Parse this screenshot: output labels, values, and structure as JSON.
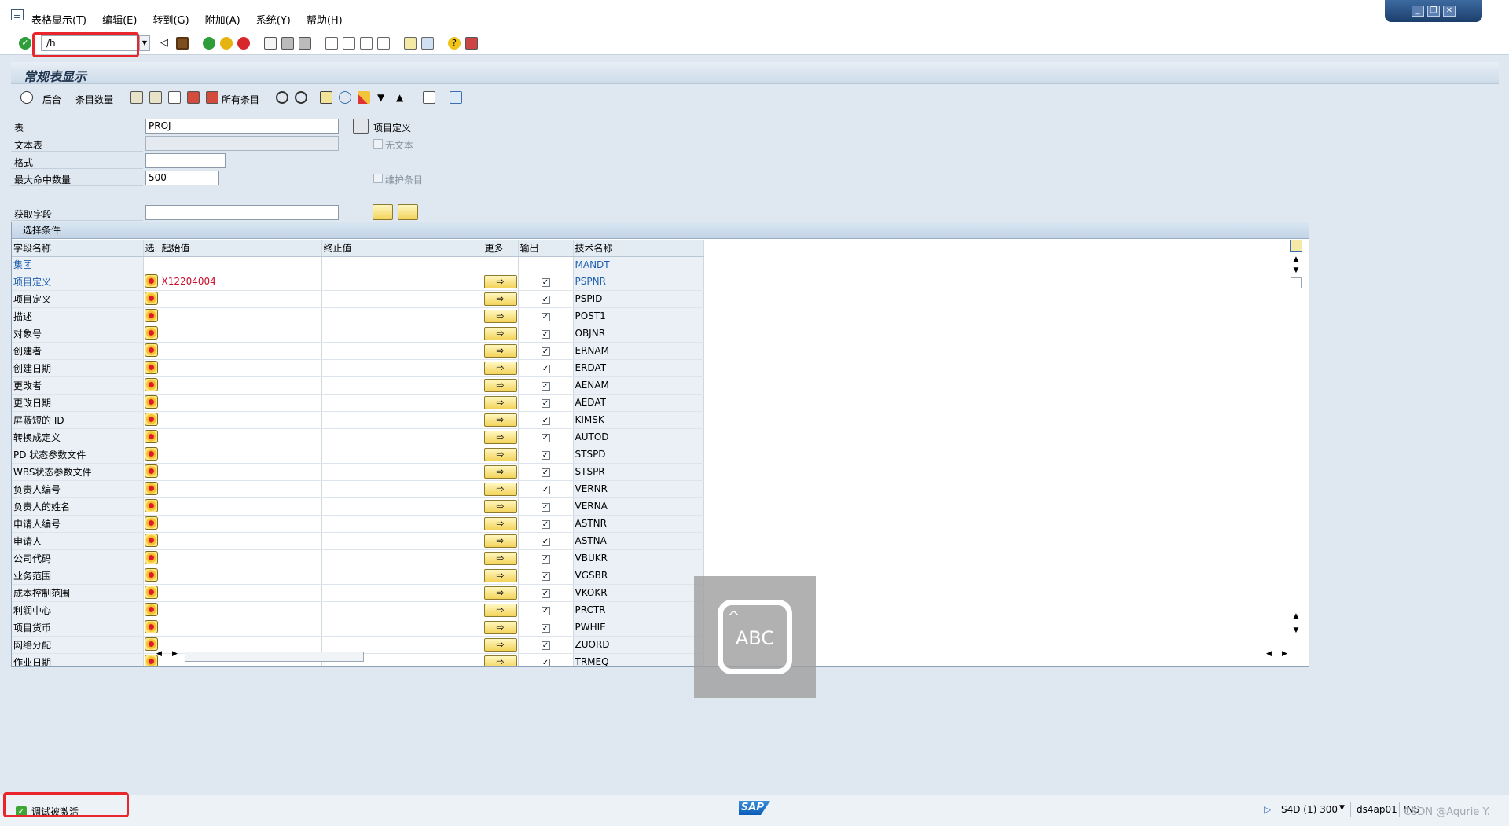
{
  "menu": [
    "表格显示(T)",
    "编辑(E)",
    "转到(G)",
    "附加(A)",
    "系统(Y)",
    "帮助(H)"
  ],
  "command_field": "/h",
  "title": "常规表显示",
  "appbar": {
    "background": "后台",
    "entry_count": "条目数量",
    "all_entries": "所有条目"
  },
  "form": {
    "table_label": "表",
    "table_value": "PROJ",
    "table_desc": "项目定义",
    "text_table_label": "文本表",
    "no_text_label": "无文本",
    "layout_label": "格式",
    "max_hits_label": "最大命中数量",
    "max_hits_value": "500",
    "maintain_entries_label": "维护条目",
    "get_fields_label": "获取字段"
  },
  "selection": {
    "caption": "选择条件",
    "columns": [
      "字段名称",
      "选.",
      "起始值",
      "终止值",
      "更多",
      "输出",
      "技术名称"
    ],
    "rows": [
      {
        "field": "集团",
        "from": "",
        "tech": "MANDT",
        "highlight": true,
        "has_controls": false
      },
      {
        "field": "项目定义",
        "from": "X12204004",
        "tech": "PSPNR",
        "highlight": true,
        "has_controls": true
      },
      {
        "field": "项目定义",
        "from": "",
        "tech": "PSPID",
        "highlight": false,
        "has_controls": true
      },
      {
        "field": "描述",
        "from": "",
        "tech": "POST1",
        "highlight": false,
        "has_controls": true
      },
      {
        "field": "对象号",
        "from": "",
        "tech": "OBJNR",
        "highlight": false,
        "has_controls": true
      },
      {
        "field": "创建者",
        "from": "",
        "tech": "ERNAM",
        "highlight": false,
        "has_controls": true
      },
      {
        "field": "创建日期",
        "from": "",
        "tech": "ERDAT",
        "highlight": false,
        "has_controls": true
      },
      {
        "field": "更改者",
        "from": "",
        "tech": "AENAM",
        "highlight": false,
        "has_controls": true
      },
      {
        "field": "更改日期",
        "from": "",
        "tech": "AEDAT",
        "highlight": false,
        "has_controls": true
      },
      {
        "field": "屏蔽短的 ID",
        "from": "",
        "tech": "KIMSK",
        "highlight": false,
        "has_controls": true
      },
      {
        "field": "转换成定义",
        "from": "",
        "tech": "AUTOD",
        "highlight": false,
        "has_controls": true
      },
      {
        "field": "PD 状态参数文件",
        "from": "",
        "tech": "STSPD",
        "highlight": false,
        "has_controls": true
      },
      {
        "field": "WBS状态参数文件",
        "from": "",
        "tech": "STSPR",
        "highlight": false,
        "has_controls": true
      },
      {
        "field": "负责人编号",
        "from": "",
        "tech": "VERNR",
        "highlight": false,
        "has_controls": true
      },
      {
        "field": "负责人的姓名",
        "from": "",
        "tech": "VERNA",
        "highlight": false,
        "has_controls": true
      },
      {
        "field": "申请人编号",
        "from": "",
        "tech": "ASTNR",
        "highlight": false,
        "has_controls": true
      },
      {
        "field": "申请人",
        "from": "",
        "tech": "ASTNA",
        "highlight": false,
        "has_controls": true
      },
      {
        "field": "公司代码",
        "from": "",
        "tech": "VBUKR",
        "highlight": false,
        "has_controls": true
      },
      {
        "field": "业务范围",
        "from": "",
        "tech": "VGSBR",
        "highlight": false,
        "has_controls": true
      },
      {
        "field": "成本控制范围",
        "from": "",
        "tech": "VKOKR",
        "highlight": false,
        "has_controls": true
      },
      {
        "field": "利润中心",
        "from": "",
        "tech": "PRCTR",
        "highlight": false,
        "has_controls": true
      },
      {
        "field": "项目货币",
        "from": "",
        "tech": "PWHIE",
        "highlight": false,
        "has_controls": true
      },
      {
        "field": "网络分配",
        "from": "",
        "tech": "ZUORD",
        "highlight": false,
        "has_controls": true
      },
      {
        "field": "作业日期",
        "from": "",
        "tech": "TRMEQ",
        "highlight": false,
        "has_controls": true
      }
    ]
  },
  "overlay_text": "ABC",
  "status": {
    "message": "调试被激活",
    "logo": "SAP",
    "system": "S4D (1) 300",
    "server": "ds4ap01",
    "mode": "INS"
  },
  "watermark": "CSDN @Aqurie Y."
}
